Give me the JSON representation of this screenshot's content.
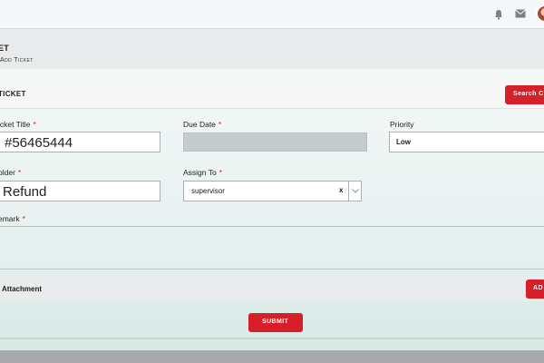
{
  "header": {
    "bell_icon": "bell-icon",
    "mail_icon": "mail-icon",
    "avatar": "user-avatar"
  },
  "page": {
    "title": "ET",
    "breadcrumb": "Add Ticket"
  },
  "card": {
    "title": "TICKET",
    "search_button": "Search C"
  },
  "form": {
    "ticket_title_label": "icket Title",
    "ticket_title_value": "#56465444",
    "due_date_label": "Due Date",
    "due_date_value": "",
    "priority_label": "Priority",
    "priority_value": "Low",
    "folder_label": "older",
    "folder_value": "Refund",
    "assign_to_label": "Assign To",
    "assign_to_value": "supervisor",
    "assign_clear": "x",
    "remark_label": "emark",
    "required_mark": "*"
  },
  "attachment": {
    "title": "Attachment",
    "add_button": "AD"
  },
  "actions": {
    "submit_button": "SUBMIT"
  },
  "colors": {
    "accent": "#d71f2a",
    "disabled_field": "#c3cdd0"
  }
}
